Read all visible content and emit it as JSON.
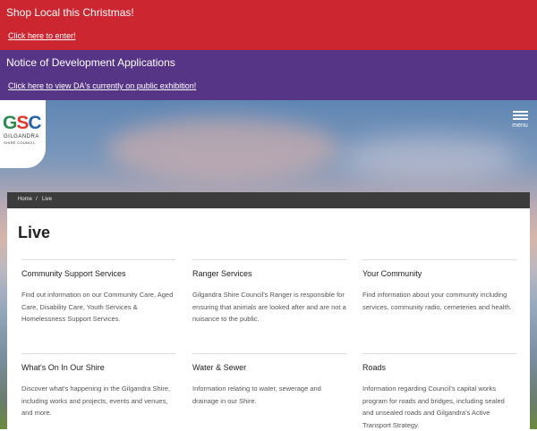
{
  "banners": [
    {
      "title": "Shop Local this Christmas!",
      "link": "Click here to enter!",
      "color": "#cc2630"
    },
    {
      "title": "Notice of Development Applications",
      "link": "Click here to view DA's currently on public exhibition!",
      "color": "#573586"
    }
  ],
  "logo": {
    "letters": [
      "G",
      "S",
      "C"
    ],
    "line1": "GILGANDRA",
    "line2": "SHIRE COUNCIL"
  },
  "menu": {
    "label": "menu",
    "icon": "hamburger-icon"
  },
  "breadcrumb": {
    "home": "Home",
    "separator": "/",
    "current": "Live"
  },
  "page": {
    "title": "Live"
  },
  "cards": [
    {
      "title": "Community Support Services",
      "desc": "Find out information on our Community Care, Aged Care, Disability Care, Youth Services & Homelessness Support Services."
    },
    {
      "title": "Ranger Services",
      "desc": "Gilgandra Shire Council's Ranger is responsible for ensuring that animals are looked after and are not a nuisance to the public."
    },
    {
      "title": "Your Community",
      "desc": "Find information about your community including services, community radio, cemeteries and health."
    },
    {
      "title": "What's On In Our Shire",
      "desc": "Discover what's happening in the Gilgandra Shire, including works and projects, events and venues, and more."
    },
    {
      "title": "Water & Sewer",
      "desc": "Information relating to water, sewerage and drainage in our Shire."
    },
    {
      "title": "Roads",
      "desc": "Information regarding Council's capital works program for roads and bridges, including sealed and unsealed roads and Gilgandra's Active Transport Strategy."
    }
  ]
}
